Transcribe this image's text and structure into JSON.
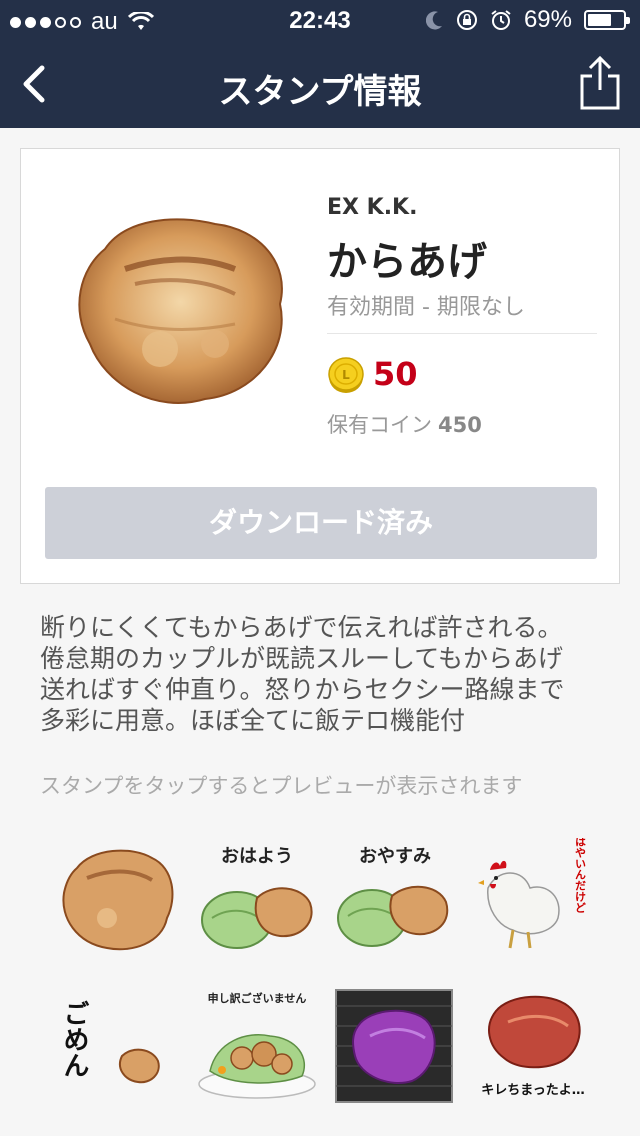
{
  "status_bar": {
    "carrier": "au",
    "time": "22:43",
    "battery_percent_label": "69%",
    "battery_level": 0.69
  },
  "nav": {
    "title": "スタンプ情報",
    "back_icon": "chevron-left-icon",
    "share_icon": "share-icon"
  },
  "sticker": {
    "publisher": "EX K.K.",
    "name": "からあげ",
    "validity": "有効期間 - 期限なし",
    "price": "50",
    "owned_coins_label": "保有コイン",
    "owned_coins": "450",
    "download_label": "ダウンロード済み"
  },
  "description": {
    "lines": [
      "断りにくくてもからあげで伝えれば許される。",
      "倦怠期のカップルが既読スルーしてもからあげ",
      "送ればすぐ仲直り。怒りからセクシー路線まで",
      "多彩に用意。ほぼ全てに飯テロ機能付"
    ]
  },
  "preview_hint": "スタンプをタップするとプレビューが表示されます",
  "stickers": [
    {
      "caption": ""
    },
    {
      "caption": "おはよう"
    },
    {
      "caption": "おやすみ"
    },
    {
      "caption": "明日朝はやいんだけど"
    },
    {
      "caption": "ごめん"
    },
    {
      "caption": "申し訳ございません"
    },
    {
      "caption": ""
    },
    {
      "caption": "キレちまったよ…"
    }
  ],
  "colors": {
    "nav_bg": "#243048",
    "price_red": "#c40018",
    "button_disabled": "#cdd0d8"
  }
}
